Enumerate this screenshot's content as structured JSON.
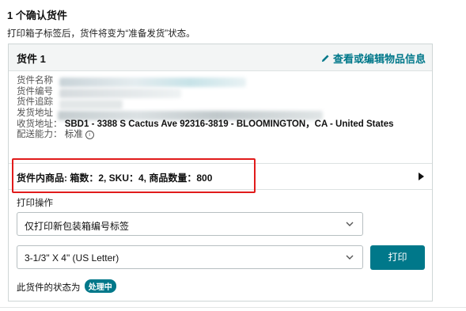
{
  "page": {
    "heading": "1 个确认货件",
    "subtext": "打印箱子标签后，货件将变为“准备发货”状态。"
  },
  "shipment": {
    "title": "货件 1",
    "edit_link": "查看或编辑物品信息",
    "fields": [
      {
        "label": "货件名称",
        "value": ""
      },
      {
        "label": "货件编号",
        "value": ""
      },
      {
        "label": "货件追踪",
        "value": ""
      },
      {
        "label": "发货地址",
        "value": ""
      },
      {
        "label": "收货地址：",
        "value": "SBD1 - 3388 S Cactus Ave 92316-3819 - BLOOMINGTON，CA - United States"
      },
      {
        "label": "配送能力：",
        "value": "标准"
      }
    ],
    "contents_summary": "货件内商品: 箱数：2, SKU：4, 商品数量：800"
  },
  "print": {
    "section_label": "打印操作",
    "action_select_value": "仅打印新包装箱编号标签",
    "paper_select_value": "3-1/3\" X 4\" (US Letter)",
    "print_button": "打印"
  },
  "status": {
    "prefix": "此货件的状态为",
    "badge": "处理中"
  },
  "colors": {
    "accent": "#00788a",
    "highlight_border": "#e11b1b"
  },
  "icons": [
    "pencil-icon",
    "info-icon",
    "chevron-down-icon",
    "triangle-right-icon"
  ]
}
